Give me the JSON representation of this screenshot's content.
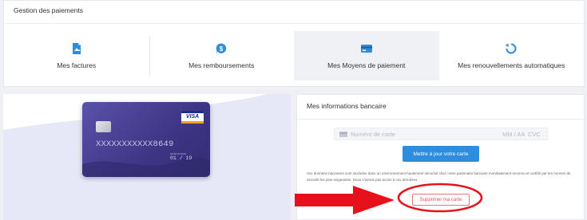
{
  "header": {
    "title": "Gestion des paiements"
  },
  "tabs": [
    {
      "label": "Mes factures",
      "icon": "invoice-icon",
      "active": false
    },
    {
      "label": "Mes remboursements",
      "icon": "refund-icon",
      "active": false
    },
    {
      "label": "Mes Moyens de paiement",
      "icon": "credit-card-icon",
      "active": true
    },
    {
      "label": "Mes renouvellements automatiques",
      "icon": "renew-icon",
      "active": false
    }
  ],
  "card": {
    "number": "XXXXXXXXXXX8649",
    "expiry_label": "MONTH/YEAR",
    "expiry": "01 / 19",
    "brand": "VISA"
  },
  "bank_info": {
    "title": "Mes informations bancaire",
    "card_number_placeholder": "Numéro de carte",
    "expiry_placeholder": "MM / AA",
    "cvc_placeholder": "CVC",
    "update_button": "Mettre à jour votre carte",
    "disclaimer": "Vos données bancaires sont stockées dans un environnement hautement sécurisé chez notre partenaire bancaire mondialement reconnu et certifié par les normes de sécurité les plus exigeantes. Nous n'avons pas accès à ces dernières.",
    "delete_button": "Supprimer ma carte"
  },
  "colors": {
    "accent": "#2f8ddf",
    "card": "#3e3585",
    "danger": "#e8505b",
    "annotation": "#e8101a"
  }
}
